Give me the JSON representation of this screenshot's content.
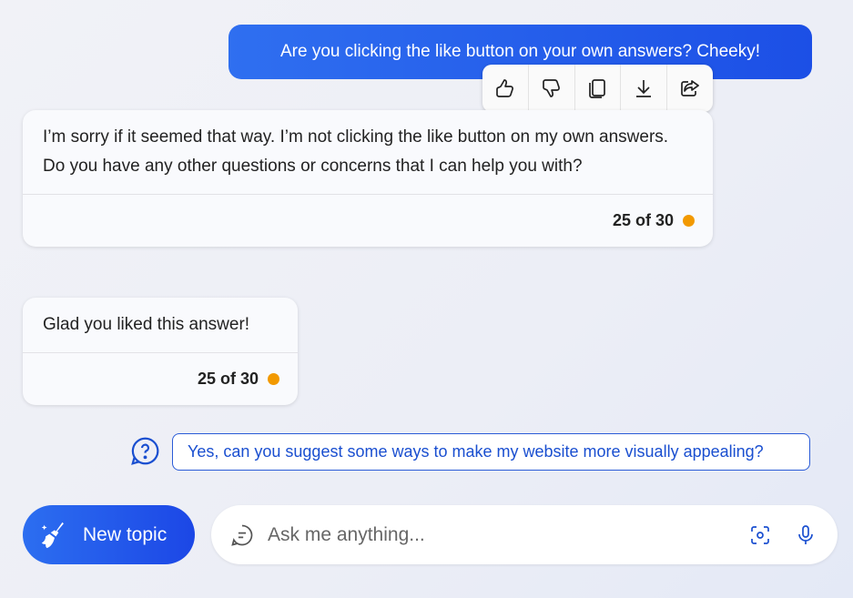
{
  "user_message": "Are you clicking the like button on your own answers? Cheeky!",
  "actions": [
    {
      "icon": "thumbs-up-icon"
    },
    {
      "icon": "thumbs-down-icon"
    },
    {
      "icon": "copy-icon"
    },
    {
      "icon": "download-icon"
    },
    {
      "icon": "share-icon"
    }
  ],
  "responses": [
    {
      "text": "I’m sorry if it seemed that way. I’m not clicking the like button on my own answers. Do you have any other questions or concerns that I can help you with?",
      "counter": "25 of 30"
    },
    {
      "text": "Glad you liked this answer!",
      "counter": "25 of 30"
    }
  ],
  "suggestion": "Yes, can you suggest some ways to make my website more visually appealing?",
  "new_topic": "New topic",
  "input": {
    "placeholder": "Ask me anything...",
    "value": ""
  },
  "colors": {
    "accent": "#1c4fe6",
    "status_dot": "#f29900"
  }
}
